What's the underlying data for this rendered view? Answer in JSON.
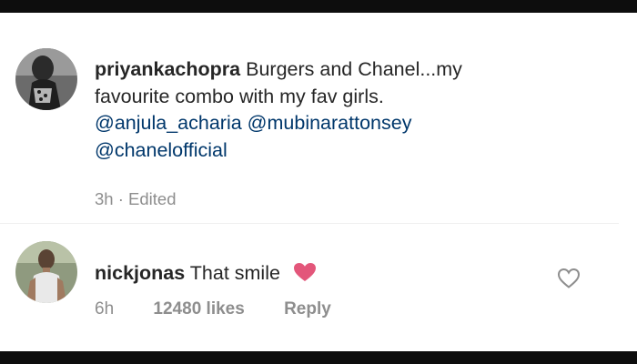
{
  "post": {
    "username": "priyankachopra",
    "caption_line1": "Burgers and Chanel...my",
    "caption_line2": "favourite combo with my fav girls.",
    "mention1": "@anjula_acharia",
    "mention2": "@mubinarattonsey",
    "mention3": "@chanelofficial",
    "time": "3h",
    "separator": "·",
    "edited": "Edited"
  },
  "comment": {
    "username": "nickjonas",
    "text": "That smile",
    "emoji_icon": "heart-emoji-icon",
    "time": "6h",
    "likes": "12480 likes",
    "reply_label": "Reply",
    "like_icon": "heart-outline-icon"
  },
  "colors": {
    "text": "#262626",
    "mention": "#00376b",
    "secondary": "#8e8e8e",
    "heart": "#e3567a",
    "background": "#ffffff",
    "border": "#0d0d0d"
  }
}
